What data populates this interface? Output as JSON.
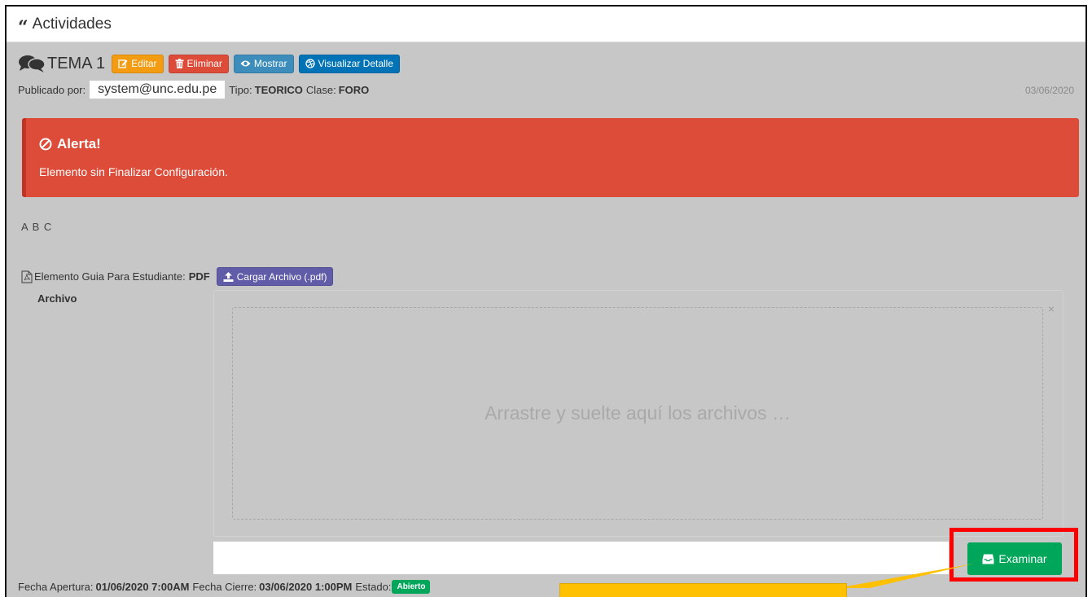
{
  "header": {
    "title": "Actividades"
  },
  "tema": {
    "title": "TEMA 1",
    "buttons": {
      "editar": "Editar",
      "eliminar": "Eliminar",
      "mostrar": "Mostrar",
      "visualizar": "Visualizar Detalle"
    }
  },
  "published": {
    "label": "Publicado por:",
    "email": "system@unc.edu.pe",
    "tipo_label": "Tipo:",
    "tipo_value": "TEORICO",
    "clase_label": "Clase:",
    "clase_value": "FORO",
    "date": "03/06/2020"
  },
  "alert": {
    "title": "Alerta!",
    "message": "Elemento sin Finalizar Configuración."
  },
  "description": "A B C",
  "guia": {
    "label": "Elemento Guia Para Estudiante:",
    "format": "PDF",
    "upload_button": "Cargar Archivo (.pdf)"
  },
  "upload": {
    "field_label": "Archivo",
    "dropzone_text": "Arrastre y suelte aquí los archivos …",
    "close": "×",
    "browse_button": "Examinar"
  },
  "fechas": {
    "apertura_label": "Fecha Apertura:",
    "apertura_value": "01/06/2020 7:00AM",
    "cierre_label": "Fecha Cierre:",
    "cierre_value": "03/06/2020 1:00PM",
    "estado_label": "Estado:",
    "estado_value": "Abierto"
  },
  "colors": {
    "panel_bg": "#c7c7c7",
    "danger": "#dd4b39",
    "warning": "#f39c12",
    "info": "#3c8dbc",
    "primary": "#0073b7",
    "purple": "#605ca8",
    "success": "#00a65a",
    "highlight": "#ff0000",
    "callout": "#ffc000"
  },
  "icons": {
    "header": "quote-left-icon",
    "tema": "comments-icon",
    "editar": "edit-icon",
    "eliminar": "trash-icon",
    "mostrar": "eye-icon",
    "visualizar": "dribbble-icon",
    "alert": "ban-icon",
    "guia": "file-pdf-icon",
    "cargar": "upload-icon",
    "examinar": "inbox-icon"
  }
}
